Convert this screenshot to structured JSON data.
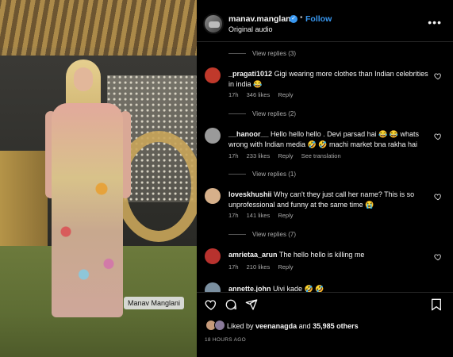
{
  "photo": {
    "tag_label": "Manav Manglani"
  },
  "header": {
    "username": "manav.manglani",
    "follow_label": "Follow",
    "separator": "•",
    "audio": "Original audio",
    "more_label": "•••"
  },
  "comments": [
    {
      "type": "replies",
      "label": "View replies (3)"
    },
    {
      "type": "comment",
      "username": "_pragati1012",
      "text": "Gigi wearing more clothes than Indian celebrities in india 😂",
      "time": "17h",
      "likes": "346 likes",
      "reply": "Reply",
      "extra": "",
      "avatar_color": "#c0392b"
    },
    {
      "type": "replies",
      "label": "View replies (2)"
    },
    {
      "type": "comment",
      "username": "__hanoor__",
      "text": "Hello hello hello . Devi parsad hai 😂 😂 whats wrong with Indian media 🤣 🤣 machi market bna rakha hai",
      "time": "17h",
      "likes": "233 likes",
      "reply": "Reply",
      "extra": "See translation",
      "avatar_color": "#9a9a9a"
    },
    {
      "type": "replies",
      "label": "View replies (1)"
    },
    {
      "type": "comment",
      "username": "loveskhushii",
      "text": "Why can't they just call her name? This is so unprofessional and funny at the same time 😭",
      "time": "17h",
      "likes": "141 likes",
      "reply": "Reply",
      "extra": "",
      "avatar_color": "#d6b08a"
    },
    {
      "type": "replies",
      "label": "View replies (7)"
    },
    {
      "type": "comment",
      "username": "amrietaa_arun",
      "text": "The hello hello is killing me",
      "time": "17h",
      "likes": "210 likes",
      "reply": "Reply",
      "extra": "",
      "avatar_color": "#b8322e"
    },
    {
      "type": "comment",
      "username": "annette.john",
      "text": "Uivi kade 🤣 🤣",
      "time": "",
      "likes": "",
      "reply": "",
      "extra": "",
      "avatar_color": "#7a8fa0"
    }
  ],
  "liked_by": {
    "prefix": "Liked by",
    "user": "veenanagda",
    "and": "and",
    "others": "35,985 others"
  },
  "timestamp": "18 HOURS AGO",
  "colors": {
    "accent": "#3897f0",
    "background": "#000000",
    "muted": "#a8a8a8"
  },
  "icons": [
    "heart-icon",
    "comment-icon",
    "share-icon",
    "bookmark-icon",
    "more-icon",
    "verified-icon"
  ]
}
